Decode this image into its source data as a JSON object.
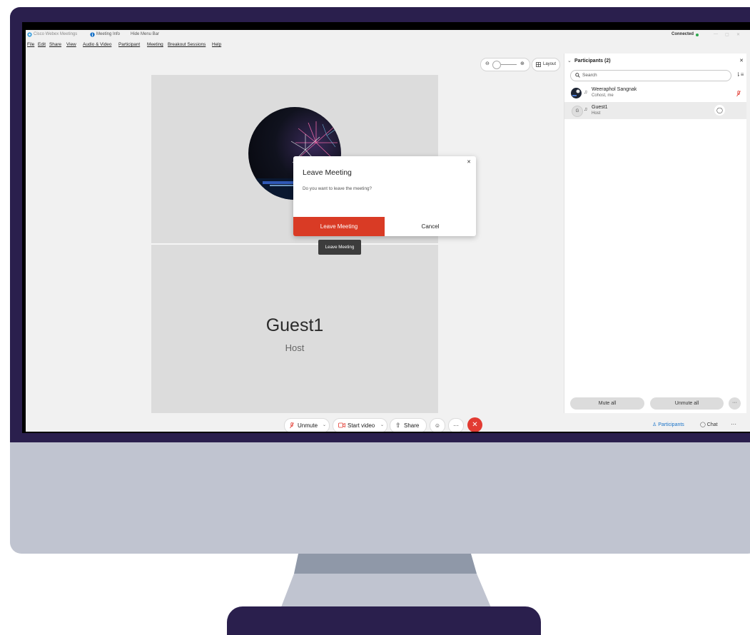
{
  "window": {
    "app_title": "Cisco Webex Meetings",
    "meeting_info": "Meeting Info",
    "hide_menu_bar": "Hide Menu Bar",
    "status": "Connected"
  },
  "menu": [
    "File",
    "Edit",
    "Share",
    "View",
    "Audio & Video",
    "Participant",
    "Meeting",
    "Breakout Sessions",
    "Help"
  ],
  "stage": {
    "layout_label": "Layout",
    "guest_name": "Guest1",
    "guest_role": "Host"
  },
  "dialog": {
    "title": "Leave Meeting",
    "message": "Do you want to leave the meeting?",
    "confirm_label": "Leave Meeting",
    "cancel_label": "Cancel",
    "tooltip": "Leave Meeting",
    "confirm_color": "#d93b25"
  },
  "participants": {
    "header": "Participants (2)",
    "search_placeholder": "Search",
    "list": [
      {
        "name": "Weeraphol Sangnak",
        "role": "Cohost, me",
        "muted": true
      },
      {
        "name": "Guest1",
        "role": "Host",
        "initial": "G"
      }
    ],
    "mute_all": "Mute all",
    "unmute_all": "Unmute all"
  },
  "toolbar": {
    "unmute": "Unmute",
    "start_video": "Start video",
    "share": "Share",
    "participants": "Participants",
    "chat": "Chat"
  },
  "colors": {
    "accent_blue": "#1a73c8",
    "status_green": "#2fa84f",
    "end_red": "#e23b32",
    "monitor_frame": "#2a1f4d"
  }
}
